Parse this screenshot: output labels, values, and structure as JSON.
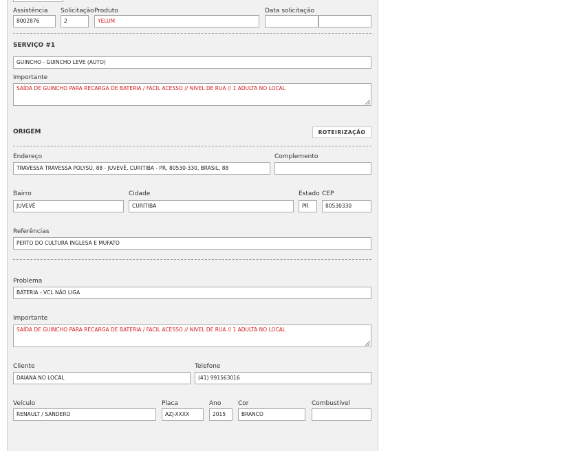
{
  "header": {
    "assistencia": {
      "label": "Assistência",
      "value": "8002876"
    },
    "solicitacao": {
      "label": "Solicitação",
      "value": "2"
    },
    "produto": {
      "label": "Produto",
      "value": "YELUM"
    },
    "data_solicitacao": {
      "label": "Data solicitação",
      "date": "",
      "time": ""
    }
  },
  "servico": {
    "title": "SERVIÇO #1",
    "tipo": "GUINCHO - GUINCHO LEVE (AUTO)",
    "importante_label": "Importante",
    "importante": "SAÍDA DE GUINCHO PARA RECARGA DE BATERIA / FACIL ACESSO // NIVEL DE RUA // 1 ADULTA NO LOCAL"
  },
  "origem": {
    "title": "ORIGEM",
    "roteirizacao_label": "ROTEIRIZAÇÃO",
    "endereco": {
      "label": "Endereço",
      "value": "TRAVESSA TRAVESSA POLYSÚ, 88 - JUVEVÊ, CURITIBA - PR, 80530-330, BRASIL, 88"
    },
    "complemento": {
      "label": "Complemento",
      "value": ""
    },
    "bairro": {
      "label": "Bairro",
      "value": "JUVEVÊ"
    },
    "cidade": {
      "label": "Cidade",
      "value": "CURITIBA"
    },
    "estado": {
      "label": "Estado",
      "value": "PR"
    },
    "cep": {
      "label": "CEP",
      "value": "80530330"
    },
    "referencias": {
      "label": "Referências",
      "value": "PERTO DO CULTURA INGLESA E MUFATO"
    }
  },
  "detalhes": {
    "problema": {
      "label": "Problema",
      "value": "BATERIA - VCL NÃO LIGA"
    },
    "importante_label": "Importante",
    "importante": "SAÍDA DE GUINCHO PARA RECARGA DE BATERIA / FACIL ACESSO // NIVEL DE RUA // 1 ADULTA NO LOCAL",
    "cliente": {
      "label": "Cliente",
      "value": "DAIANA NO LOCAL"
    },
    "telefone": {
      "label": "Telefone",
      "value": "(41) 991563016"
    },
    "veiculo": {
      "label": "Veículo",
      "value": "RENAULT / SANDERO"
    },
    "placa": {
      "label": "Placa",
      "value": "AZJ-XXXX"
    },
    "ano": {
      "label": "Ano",
      "value": "2015"
    },
    "cor": {
      "label": "Cor",
      "value": "BRANCO"
    },
    "combustivel": {
      "label": "Combustível",
      "value": ""
    }
  }
}
